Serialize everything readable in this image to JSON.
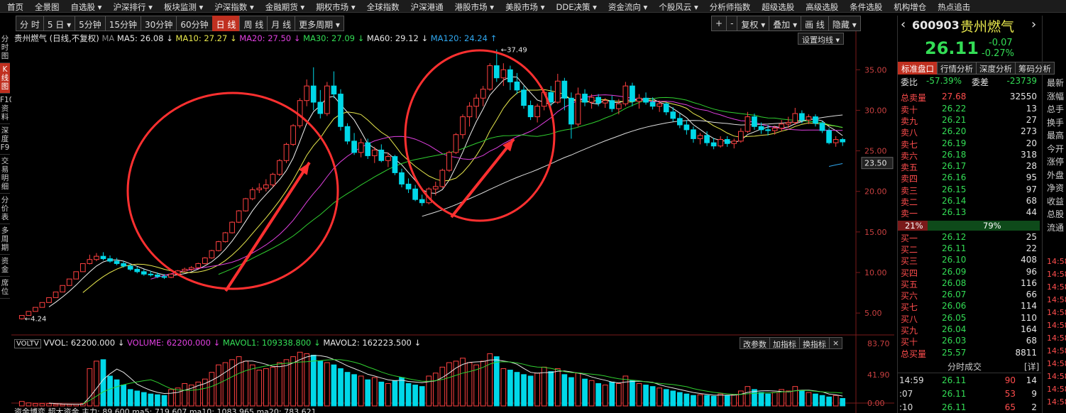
{
  "menu": [
    "首页",
    "全景图",
    "自选股 ▾",
    "沪深排行 ▾",
    "板块监测 ▾",
    "沪深指数 ▾",
    "金融期货 ▾",
    "期权市场 ▾",
    "全球指数",
    "沪深港通",
    "港股市场 ▾",
    "美股市场 ▾",
    "DDE决策 ▾",
    "资金流向 ▾",
    "个股风云 ▾",
    "分析师指数",
    "超级选股",
    "高级选股",
    "条件选股",
    "机构增仓",
    "热点追击"
  ],
  "toolbar": [
    "分 时",
    "5 日 ▾",
    "5分钟",
    "15分钟",
    "30分钟",
    "60分钟",
    "日 线",
    "周 线",
    "月 线",
    "更多周期 ▾"
  ],
  "toolbar_active": "日 线",
  "toolbar_right": [
    "+",
    "-",
    "复权 ▾",
    "叠加 ▾",
    "画 线",
    "隐藏 ▾"
  ],
  "left_tabs": [
    "分时图",
    "K线图",
    "F10资料",
    "深度F9",
    "交易明细",
    "分价表",
    "多周期",
    "资金",
    "席位"
  ],
  "left_tab_active": "K线图",
  "legend": {
    "name": "贵州燃气 (日线,不复权)",
    "ma5": "MA5: 26.08",
    "ma10": "MA10: 27.27",
    "ma20": "MA20: 27.50",
    "ma30": "MA30: 27.09",
    "ma60": "MA60: 29.12",
    "ma120": "MA120: 24.24",
    "ma_tag": "MA",
    "set_ma": "设置均线 ▾"
  },
  "price_axis": [
    "35.00",
    "30.00",
    "25.00",
    "20.00",
    "15.00",
    "10.00",
    "5.00"
  ],
  "current_price_tag": "23.50",
  "high_label": "37.49",
  "low_label": "4.24",
  "volume_legend": {
    "tag": "VOLTV",
    "vvol": "VVOL: 62200.000",
    "volume": "VOLUME: 62200.000",
    "mavol1": "MAVOL1: 109338.800",
    "mavol2": "MAVOL2: 162223.500",
    "btn1": "改参数",
    "btn2": "加指标",
    "btn3": "换指标"
  },
  "volume_axis": [
    "83.70",
    "41.90",
    "0.00"
  ],
  "bottom_legend": "资金博弈 超大资金 主力: 89.600  ma5: 719.607  ma10: 1083.965  ma20: 783.621",
  "stock": {
    "code": "600903",
    "name": "贵州燃气",
    "price": "26.11",
    "change": "-0.07",
    "change_pct": "-0.27%",
    "tabs": [
      "标准盘口",
      "行情分析",
      "深度分析",
      "筹码分析"
    ],
    "weibi_label": "委比",
    "weibi": "-57.39%",
    "weicha_label": "委差",
    "weicha": "-23739",
    "total_sell_label": "总卖量",
    "total_sell_price": "27.68",
    "total_sell_vol": "32550",
    "sells": [
      {
        "label": "卖十",
        "price": "26.22",
        "vol": "13"
      },
      {
        "label": "卖九",
        "price": "26.21",
        "vol": "27"
      },
      {
        "label": "卖八",
        "price": "26.20",
        "vol": "273"
      },
      {
        "label": "卖七",
        "price": "26.19",
        "vol": "20"
      },
      {
        "label": "卖六",
        "price": "26.18",
        "vol": "318"
      },
      {
        "label": "卖五",
        "price": "26.17",
        "vol": "28"
      },
      {
        "label": "卖四",
        "price": "26.16",
        "vol": "95"
      },
      {
        "label": "卖三",
        "price": "26.15",
        "vol": "97"
      },
      {
        "label": "卖二",
        "price": "26.14",
        "vol": "68"
      },
      {
        "label": "卖一",
        "price": "26.13",
        "vol": "44"
      }
    ],
    "ratio_left": "21%",
    "ratio_right": "79%",
    "ratio_fraction": 0.21,
    "buys": [
      {
        "label": "买一",
        "price": "26.12",
        "vol": "25"
      },
      {
        "label": "买二",
        "price": "26.11",
        "vol": "22"
      },
      {
        "label": "买三",
        "price": "26.10",
        "vol": "408"
      },
      {
        "label": "买四",
        "price": "26.09",
        "vol": "96"
      },
      {
        "label": "买五",
        "price": "26.08",
        "vol": "116"
      },
      {
        "label": "买六",
        "price": "26.07",
        "vol": "66"
      },
      {
        "label": "买七",
        "price": "26.06",
        "vol": "114"
      },
      {
        "label": "买八",
        "price": "26.05",
        "vol": "110"
      },
      {
        "label": "买九",
        "price": "26.04",
        "vol": "164"
      },
      {
        "label": "买十",
        "price": "26.03",
        "vol": "68"
      }
    ],
    "total_buy_label": "总买量",
    "total_buy_price": "25.57",
    "total_buy_vol": "8811",
    "ticks_title": "分时成交",
    "ticks_detail": "[详]",
    "ticks": [
      {
        "time": "14:59",
        "price": "26.11",
        "vol": "90",
        "n": "14"
      },
      {
        "time": ":07",
        "price": "26.11",
        "vol": "53",
        "n": "9"
      },
      {
        "time": ":10",
        "price": "26.11",
        "vol": "65",
        "n": "2"
      }
    ]
  },
  "side_panel": [
    "最新",
    "涨幅",
    "总手",
    "换手",
    "最高",
    "今开",
    "涨停",
    "外盘",
    "净资",
    "收益",
    "总股",
    "流通"
  ],
  "side_times": [
    "14:58",
    "14:58",
    "14:58",
    "14:58",
    "14:58",
    "14:58",
    "14:58",
    "14:58",
    "14:58",
    "14:58",
    "14:58",
    "14:58"
  ],
  "colors": {
    "up": "#ff4040",
    "down": "#00d8e8",
    "ma5": "#f0f0f0",
    "ma10": "#e8e84d",
    "ma20": "#e040e0",
    "ma30": "#30d030",
    "ma60": "#d0d0d0",
    "ma120": "#30a8f0",
    "circle": "#ff3030"
  },
  "chart_data": {
    "type": "candlestick",
    "price_range": [
      3,
      38
    ],
    "volume_range": [
      0,
      83.7
    ],
    "candles": [
      [
        4.3,
        4.7,
        4.2,
        4.7
      ],
      [
        4.7,
        5.2,
        4.7,
        5.2
      ],
      [
        5.2,
        5.7,
        5.2,
        5.7
      ],
      [
        5.7,
        6.3,
        5.7,
        6.3
      ],
      [
        6.3,
        6.9,
        6.3,
        6.9
      ],
      [
        6.9,
        7.6,
        6.9,
        7.6
      ],
      [
        7.6,
        8.4,
        7.6,
        8.4
      ],
      [
        8.4,
        9.2,
        8.4,
        9.2
      ],
      [
        9.2,
        10.1,
        9.2,
        10.1
      ],
      [
        10.1,
        11.1,
        10.1,
        11.1
      ],
      [
        11.1,
        12.2,
        11.0,
        11.6
      ],
      [
        11.6,
        12.4,
        11.4,
        12.0
      ],
      [
        12.0,
        12.5,
        11.5,
        11.7
      ],
      [
        11.7,
        12.1,
        11.2,
        11.4
      ],
      [
        11.4,
        11.8,
        10.9,
        11.1
      ],
      [
        11.1,
        11.4,
        10.6,
        10.8
      ],
      [
        10.8,
        11.0,
        10.2,
        10.4
      ],
      [
        10.4,
        10.7,
        9.9,
        10.1
      ],
      [
        10.1,
        10.4,
        9.6,
        9.8
      ],
      [
        9.8,
        10.2,
        9.5,
        9.7
      ],
      [
        9.7,
        10.0,
        9.3,
        9.5
      ],
      [
        9.5,
        9.8,
        9.2,
        9.4
      ],
      [
        9.4,
        9.9,
        9.3,
        9.8
      ],
      [
        9.8,
        10.3,
        9.6,
        10.2
      ],
      [
        10.2,
        10.6,
        10.0,
        10.4
      ],
      [
        10.4,
        10.8,
        10.2,
        10.6
      ],
      [
        10.6,
        11.2,
        10.5,
        11.1
      ],
      [
        11.1,
        11.9,
        11.0,
        11.8
      ],
      [
        11.8,
        12.8,
        11.7,
        12.7
      ],
      [
        12.7,
        13.9,
        12.6,
        13.8
      ],
      [
        13.8,
        15.0,
        13.7,
        14.9
      ],
      [
        14.9,
        16.3,
        14.8,
        16.2
      ],
      [
        16.2,
        17.7,
        16.1,
        17.6
      ],
      [
        17.6,
        19.2,
        17.5,
        19.1
      ],
      [
        19.1,
        20.5,
        18.9,
        20.2
      ],
      [
        20.2,
        21.0,
        19.8,
        20.4
      ],
      [
        20.4,
        21.5,
        20.0,
        20.8
      ],
      [
        20.8,
        22.3,
        20.5,
        22.1
      ],
      [
        22.1,
        24.0,
        21.9,
        23.8
      ],
      [
        23.8,
        26.0,
        23.5,
        25.8
      ],
      [
        25.8,
        28.3,
        25.6,
        28.1
      ],
      [
        28.1,
        31.5,
        27.8,
        31.2
      ],
      [
        31.2,
        33.8,
        30.5,
        33.0
      ],
      [
        33.0,
        35.3,
        30.0,
        31.0
      ],
      [
        31.0,
        32.5,
        29.0,
        29.6
      ],
      [
        29.6,
        33.5,
        29.3,
        33.0
      ],
      [
        33.0,
        34.8,
        31.5,
        32.0
      ],
      [
        32.0,
        32.6,
        27.5,
        28.0
      ],
      [
        28.0,
        28.4,
        25.8,
        26.2
      ],
      [
        26.2,
        27.2,
        24.5,
        24.8
      ],
      [
        24.8,
        26.5,
        24.2,
        26.0
      ],
      [
        26.0,
        26.5,
        24.0,
        24.4
      ],
      [
        24.4,
        25.5,
        23.5,
        25.1
      ],
      [
        25.1,
        25.8,
        23.6,
        23.8
      ],
      [
        23.8,
        24.8,
        23.0,
        24.3
      ],
      [
        24.3,
        24.5,
        22.0,
        22.3
      ],
      [
        22.3,
        22.8,
        20.5,
        20.9
      ],
      [
        20.9,
        21.6,
        19.8,
        20.3
      ],
      [
        20.3,
        20.8,
        18.8,
        19.0
      ],
      [
        19.0,
        19.6,
        18.2,
        18.6
      ],
      [
        18.6,
        20.5,
        18.4,
        20.3
      ],
      [
        20.3,
        21.2,
        19.5,
        20.6
      ],
      [
        20.6,
        22.8,
        20.4,
        22.6
      ],
      [
        22.6,
        25.0,
        22.4,
        24.8
      ],
      [
        24.8,
        27.2,
        24.6,
        27.0
      ],
      [
        27.0,
        29.5,
        26.5,
        29.2
      ],
      [
        29.2,
        31.0,
        28.0,
        30.5
      ],
      [
        30.5,
        32.0,
        29.0,
        31.5
      ],
      [
        31.5,
        33.0,
        30.5,
        32.6
      ],
      [
        32.6,
        35.8,
        32.4,
        35.5
      ],
      [
        35.5,
        37.5,
        33.5,
        34.0
      ],
      [
        34.0,
        35.8,
        33.0,
        35.0
      ],
      [
        35.0,
        35.5,
        32.5,
        33.5
      ],
      [
        33.5,
        34.6,
        32.0,
        32.5
      ],
      [
        32.5,
        33.0,
        30.2,
        30.6
      ],
      [
        30.6,
        31.2,
        28.8,
        29.2
      ],
      [
        29.2,
        30.8,
        28.5,
        30.5
      ],
      [
        30.5,
        32.5,
        30.0,
        32.2
      ],
      [
        32.2,
        33.0,
        30.5,
        31.0
      ],
      [
        31.0,
        34.5,
        30.8,
        33.6
      ],
      [
        33.6,
        34.0,
        30.0,
        31.5
      ],
      [
        31.5,
        32.2,
        26.5,
        28.3
      ],
      [
        28.3,
        32.8,
        28.0,
        32.0
      ],
      [
        32.0,
        32.6,
        30.5,
        31.0
      ],
      [
        31.0,
        32.0,
        30.2,
        31.6
      ],
      [
        31.6,
        32.0,
        30.5,
        30.9
      ],
      [
        30.9,
        31.5,
        30.3,
        31.2
      ],
      [
        31.2,
        31.8,
        29.8,
        30.2
      ],
      [
        30.2,
        31.4,
        29.5,
        30.8
      ],
      [
        30.8,
        33.5,
        30.5,
        33.0
      ],
      [
        33.0,
        33.4,
        30.5,
        31.1
      ],
      [
        31.1,
        32.0,
        30.2,
        31.5
      ],
      [
        31.5,
        32.2,
        30.7,
        31.0
      ],
      [
        31.0,
        31.6,
        30.1,
        30.5
      ],
      [
        30.5,
        31.2,
        29.8,
        30.8
      ],
      [
        30.8,
        31.0,
        29.4,
        29.8
      ],
      [
        29.8,
        30.4,
        28.6,
        29.0
      ],
      [
        29.0,
        29.6,
        27.8,
        28.2
      ],
      [
        28.2,
        28.8,
        27.0,
        27.6
      ],
      [
        27.6,
        28.0,
        26.0,
        26.5
      ],
      [
        26.5,
        27.2,
        25.8,
        26.9
      ],
      [
        26.9,
        27.4,
        25.6,
        26.0
      ],
      [
        26.0,
        26.6,
        25.2,
        25.6
      ],
      [
        25.6,
        26.8,
        25.4,
        26.4
      ],
      [
        26.4,
        26.8,
        25.5,
        25.9
      ],
      [
        25.9,
        26.5,
        25.3,
        26.2
      ],
      [
        26.2,
        27.8,
        26.0,
        27.4
      ],
      [
        27.4,
        29.8,
        27.2,
        29.2
      ],
      [
        29.2,
        29.6,
        27.6,
        28.0
      ],
      [
        28.0,
        28.5,
        27.1,
        27.6
      ],
      [
        27.6,
        28.2,
        26.9,
        27.5
      ],
      [
        27.5,
        28.1,
        27.0,
        27.8
      ],
      [
        27.8,
        28.8,
        27.4,
        28.3
      ],
      [
        28.3,
        29.2,
        27.8,
        28.5
      ],
      [
        28.5,
        30.3,
        28.2,
        29.6
      ],
      [
        29.6,
        30.0,
        28.4,
        28.8
      ],
      [
        28.8,
        29.5,
        28.3,
        29.2
      ],
      [
        29.2,
        29.5,
        28.0,
        28.4
      ],
      [
        28.4,
        28.7,
        27.2,
        27.5
      ],
      [
        27.5,
        27.8,
        25.8,
        26.0
      ],
      [
        26.0,
        26.8,
        25.5,
        26.4
      ],
      [
        26.4,
        26.6,
        25.6,
        26.1
      ]
    ],
    "volumes": [
      6,
      4,
      3,
      3,
      3,
      2,
      2,
      2,
      2,
      3,
      50,
      60,
      62,
      40,
      35,
      28,
      22,
      20,
      18,
      16,
      15,
      14,
      22,
      24,
      30,
      28,
      32,
      36,
      45,
      55,
      58,
      62,
      66,
      60,
      55,
      48,
      50,
      52,
      58,
      62,
      66,
      72,
      70,
      68,
      60,
      58,
      55,
      50,
      45,
      42,
      40,
      35,
      38,
      32,
      30,
      34,
      38,
      30,
      28,
      26,
      40,
      44,
      52,
      58,
      60,
      64,
      58,
      55,
      60,
      70,
      66,
      50,
      48,
      45,
      42,
      40,
      44,
      52,
      46,
      50,
      42,
      38,
      44,
      36,
      34,
      30,
      28,
      32,
      30,
      40,
      34,
      30,
      28,
      26,
      24,
      22,
      20,
      18,
      16,
      14,
      15,
      14,
      13,
      16,
      14,
      15,
      20,
      26,
      22,
      18,
      16,
      18,
      22,
      20,
      26,
      20,
      18,
      16,
      14,
      12,
      14,
      10
    ]
  }
}
